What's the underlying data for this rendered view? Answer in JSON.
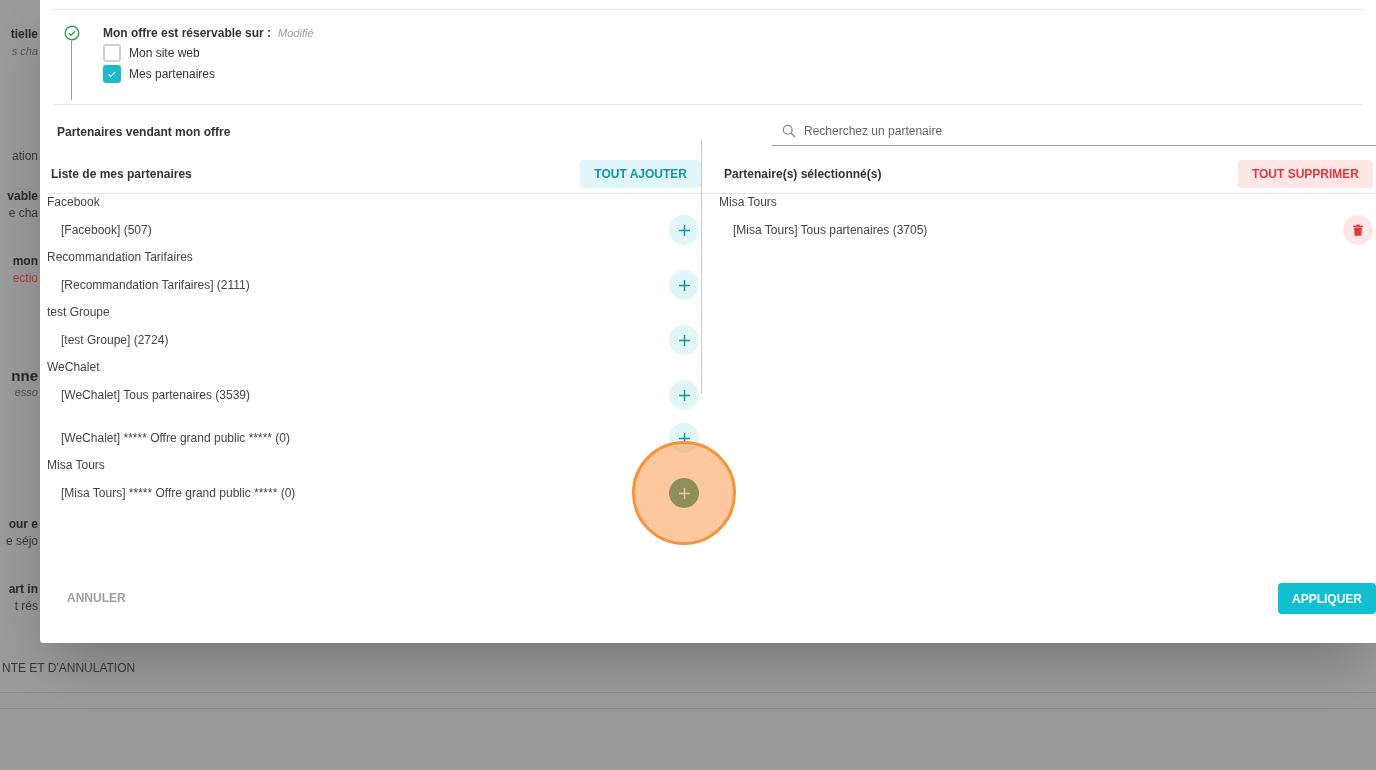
{
  "background_page": {
    "blocks": [
      {
        "lines": [
          {
            "kind": "title",
            "text": "tielle"
          },
          {
            "kind": "note",
            "text": "s cha"
          }
        ]
      },
      {
        "lines": [
          {
            "kind": "text",
            "text": "ation"
          }
        ]
      },
      {
        "lines": [
          {
            "kind": "title",
            "text": "vable"
          },
          {
            "kind": "text",
            "text": "e cha"
          }
        ]
      },
      {
        "lines": [
          {
            "kind": "title",
            "text": "mon"
          },
          {
            "kind": "error",
            "text": "ectio"
          }
        ]
      },
      {
        "lines": [
          {
            "kind": "heading",
            "text": "nne"
          },
          {
            "kind": "note",
            "text": "esso"
          }
        ]
      },
      {
        "lines": [
          {
            "kind": "title",
            "text": "our e"
          },
          {
            "kind": "text",
            "text": "e séjo"
          }
        ]
      },
      {
        "lines": [
          {
            "kind": "title",
            "text": "art in"
          },
          {
            "kind": "text",
            "text": "t rés"
          }
        ]
      }
    ],
    "section_label": "NTE ET D'ANNULATION"
  },
  "dialog": {
    "step": {
      "done": true,
      "title": "Mon offre est réservable sur :",
      "status": "Modifié",
      "options": [
        {
          "label": "Mon site web",
          "checked": false
        },
        {
          "label": "Mes partenaires",
          "checked": true
        }
      ]
    },
    "section_title": "Partenaires vendant mon offre",
    "search": {
      "placeholder": "Recherchez un partenaire"
    },
    "available": {
      "title": "Liste de mes partenaires",
      "action": "TOUT AJOUTER",
      "groups": [
        {
          "name": "Facebook",
          "partners": [
            {
              "label": "[Facebook] (507)",
              "highlighted": false
            }
          ]
        },
        {
          "name": "Recommandation Tarifaires",
          "partners": [
            {
              "label": "[Recommandation Tarifaires] (2111)",
              "highlighted": false
            }
          ]
        },
        {
          "name": "test Groupe",
          "partners": [
            {
              "label": "[test Groupe] (2724)",
              "highlighted": false
            }
          ]
        },
        {
          "name": "WeChalet",
          "partners": [
            {
              "label": "[WeChalet] Tous partenaires (3539)",
              "highlighted": false
            },
            {
              "label": "[WeChalet] ***** Offre grand public ***** (0)",
              "highlighted": false
            }
          ]
        },
        {
          "name": "Misa Tours",
          "partners": [
            {
              "label": "[Misa Tours] ***** Offre grand public ***** (0)",
              "highlighted": true
            }
          ]
        }
      ]
    },
    "selected": {
      "title": "Partenaire(s) sélectionné(s)",
      "action": "TOUT SUPPRIMER",
      "groups": [
        {
          "name": "Misa Tours",
          "partners": [
            {
              "label": "[Misa Tours] Tous partenaires (3705)"
            }
          ]
        }
      ]
    },
    "cancel": "ANNULER",
    "apply": "APPLIQUER"
  }
}
